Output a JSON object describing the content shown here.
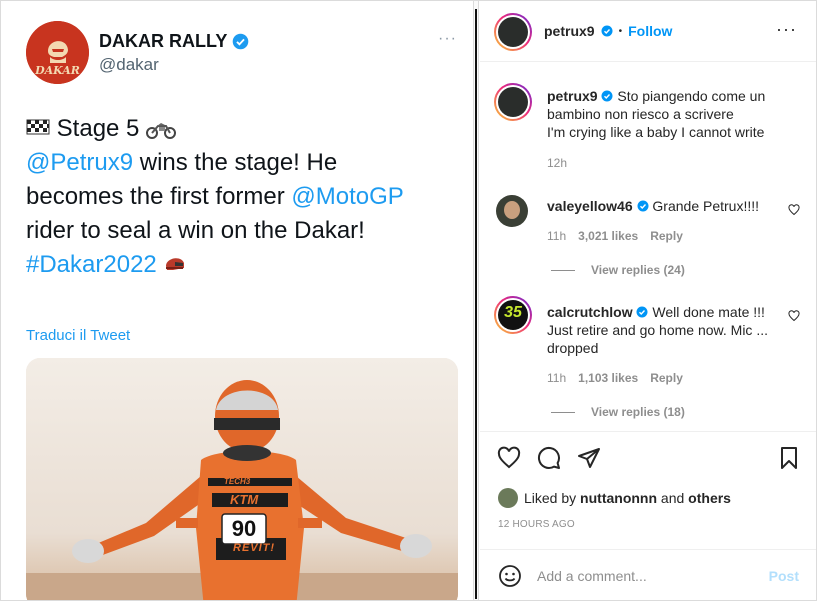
{
  "tweet": {
    "display_name": "DAKAR RALLY",
    "handle": "@dakar",
    "more": "···",
    "line1_text": "Stage 5",
    "line2_mention": "@Petrux9",
    "line2_rest": " wins the stage! He",
    "line3_text": "becomes the first former ",
    "line3_mention": "@MotoGP",
    "line4_text": "rider to seal a win on the Dakar!",
    "hashtag": "#Dakar2022",
    "translate": "Traduci il Tweet",
    "logo_text": "DAKAR",
    "rider_number": "90",
    "sponsor1": "TECH3",
    "sponsor2": "KTM",
    "sponsor3": "REVIT!"
  },
  "post": {
    "username": "petrux9",
    "follow_label": "Follow",
    "separator": "•",
    "more": "···",
    "caption_user": "petrux9",
    "caption_line1": "Sto piangendo come un",
    "caption_line2": "bambino non riesco a scrivere",
    "caption_line3": "I'm crying like a baby I cannot write",
    "caption_time": "12h"
  },
  "comments": [
    {
      "user": "valeyellow46",
      "text": " Grande Petrux!!!!",
      "time": "11h",
      "likes": "3,021 likes",
      "reply": "Reply",
      "view_replies": "View replies (24)"
    },
    {
      "user": "calcrutchlow",
      "text_line1": " Well done mate !!!",
      "text_line2": "Just retire and go home now. Mic ...",
      "text_line3": "dropped",
      "time": "11h",
      "likes": "1,103 likes",
      "reply": "Reply",
      "view_replies": "View replies (18)",
      "avatar_number": "35"
    }
  ],
  "likes": {
    "prefix": "Liked by ",
    "user": "nuttanonnn",
    "mid": " and ",
    "others": "others",
    "time_ago": "12 HOURS AGO"
  },
  "comment_box": {
    "placeholder": "Add a comment...",
    "post_label": "Post"
  },
  "colors": {
    "twitter_blue": "#1d9bf0",
    "instagram_blue": "#0095f6",
    "dakar_red": "#c8341f"
  }
}
